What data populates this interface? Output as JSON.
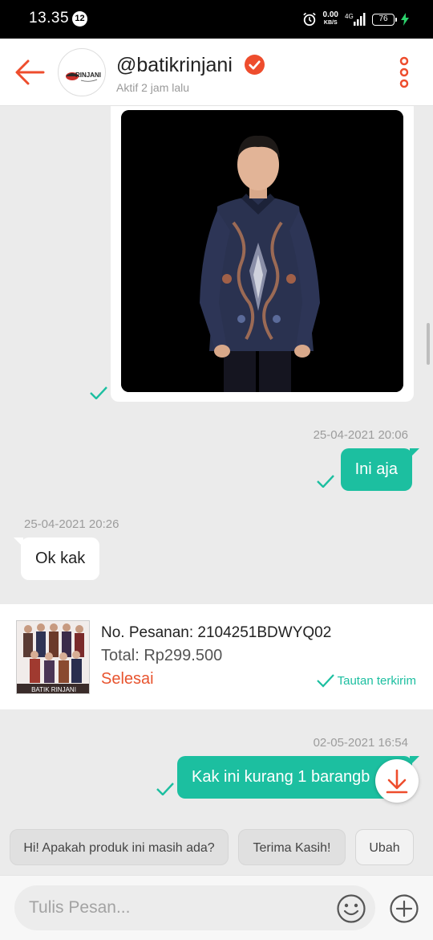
{
  "status_bar": {
    "time": "13.35",
    "notification_count": "12",
    "net_speed": "0.00",
    "net_speed_unit": "KB/S",
    "network_type": "4G",
    "battery_level": "76"
  },
  "header": {
    "shop_name": "@batikrinjani",
    "active_status": "Aktif 2 jam lalu",
    "avatar_logo_text": "RINJANI"
  },
  "messages": [
    {
      "type": "image",
      "direction": "out",
      "read": true
    },
    {
      "type": "timestamp",
      "text": "25-04-2021 20:06"
    },
    {
      "type": "text",
      "direction": "out",
      "text": "Ini aja",
      "read": true
    },
    {
      "type": "timestamp",
      "text": "25-04-2021 20:26"
    },
    {
      "type": "text",
      "direction": "in",
      "text": "Ok kak"
    },
    {
      "type": "timestamp",
      "text": "02-05-2021 16:54"
    },
    {
      "type": "text",
      "direction": "out",
      "text": "Kak ini kurang 1 barangb",
      "read": true
    }
  ],
  "order_card": {
    "order_number": "No. Pesanan: 2104251BDWYQ02",
    "total": "Total: Rp299.500",
    "status": "Selesai",
    "link_status": "Tautan terkirim",
    "thumbnail_caption": "BATIK RINJANI"
  },
  "quick_replies": [
    {
      "label": "Hi! Apakah produk ini masih ada?"
    },
    {
      "label": "Terima Kasih!"
    },
    {
      "label": "Ubah"
    }
  ],
  "input": {
    "placeholder": "Tulis Pesan..."
  },
  "colors": {
    "brand_accent": "#ee4d2d",
    "outgoing_bubble": "#1cbfa0",
    "chat_background": "#ebebeb"
  },
  "icons": [
    "back-arrow-icon",
    "verified-icon",
    "more-vertical-icon",
    "check-icon",
    "download-icon",
    "emoji-icon",
    "plus-icon",
    "alarm-icon",
    "signal-icon",
    "battery-icon"
  ]
}
